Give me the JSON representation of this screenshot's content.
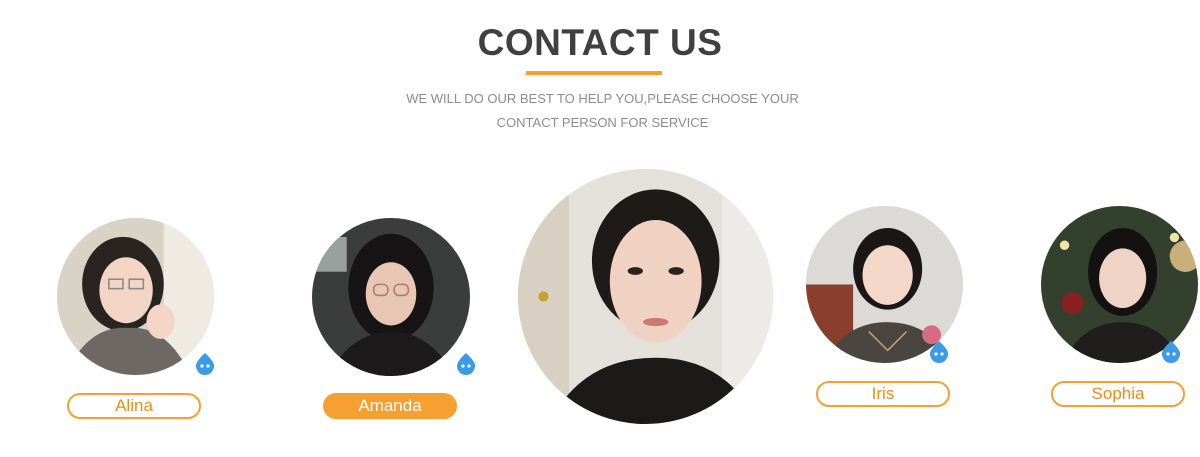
{
  "header": {
    "title": "CONTACT US",
    "subtitle_line1": "WE WILL DO OUR BEST TO HELP YOU,PLEASE CHOOSE YOUR",
    "subtitle_line2": "CONTACT PERSON FOR SERVICE"
  },
  "colors": {
    "accent": "#f7a032",
    "title": "#404040",
    "subtitle": "#8c8c8c"
  },
  "contacts": [
    {
      "name": "Alina",
      "active": false,
      "icon": "chat-bubble-icon"
    },
    {
      "name": "Amanda",
      "active": true,
      "icon": "chat-bubble-icon"
    },
    {
      "name": "",
      "active": false,
      "featured": true
    },
    {
      "name": "Iris",
      "active": false,
      "icon": "chat-bubble-icon"
    },
    {
      "name": "Sophia",
      "active": false,
      "icon": "chat-bubble-icon"
    }
  ]
}
